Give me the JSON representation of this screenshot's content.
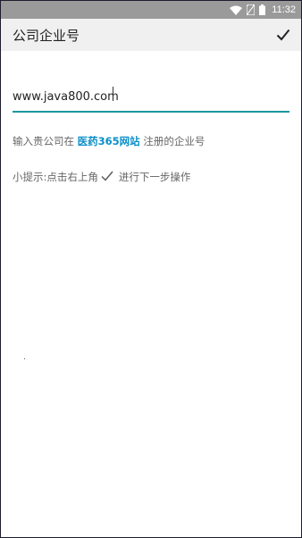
{
  "status_bar": {
    "time": "11:32",
    "icons": [
      "wifi-icon",
      "sim-off-icon",
      "battery-icon"
    ]
  },
  "app_bar": {
    "title": "公司企业号",
    "confirm_icon": "check-icon"
  },
  "form": {
    "company_value": "www.java800.com",
    "hint_prefix": "输入贵公司在",
    "site_name": "医药365网站",
    "hint_suffix": "注册的企业号"
  },
  "tip": {
    "prefix": "小提示:点击右上角",
    "icon": "check-icon",
    "suffix": "进行下一步操作"
  },
  "colors": {
    "accent": "#1b97a0",
    "link": "#0b8fc8",
    "status_bar": "#9a9a9a",
    "app_bar": "#f0f0f0"
  }
}
